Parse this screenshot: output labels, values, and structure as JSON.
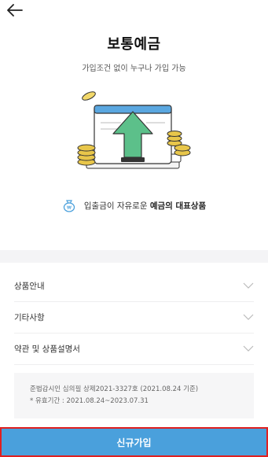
{
  "header": {
    "back_icon": "arrow-left-icon"
  },
  "product": {
    "title": "보통예금",
    "subtitle": "가입조건 없이 누구나 가입 가능"
  },
  "feature": {
    "icon": "money-bag-icon",
    "text_prefix": "입출금이 자유로운 ",
    "text_bold": "예금의 대표상품"
  },
  "accordion": {
    "items": [
      {
        "label": "상품안내"
      },
      {
        "label": "기타사항"
      },
      {
        "label": "약관 및 상품설명서"
      }
    ]
  },
  "notice": {
    "line1": "준법감시인 심의필 상제2021-3327호 (2021.08.24 기준)",
    "line2": "* 유효기간 : 2021.08.24~2023.07.31"
  },
  "cta": {
    "label": "신규가입"
  },
  "colors": {
    "accent_blue": "#4aa0dc",
    "arrow_green": "#5cc08a",
    "coin_gold": "#e8c64a"
  }
}
